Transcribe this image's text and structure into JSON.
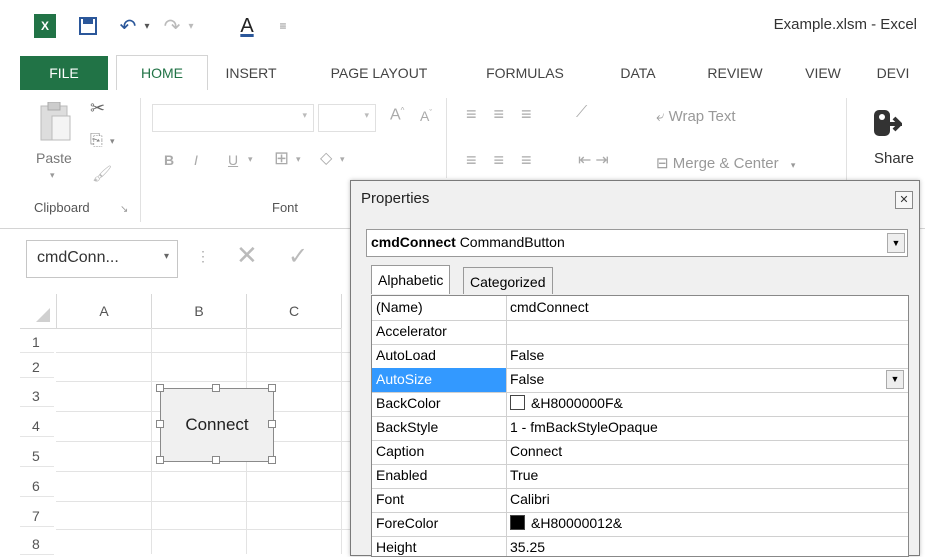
{
  "window": {
    "title": "Example.xlsm - Excel"
  },
  "ribbon": {
    "tabs": [
      {
        "label": "FILE"
      },
      {
        "label": "HOME"
      },
      {
        "label": "INSERT"
      },
      {
        "label": "PAGE LAYOUT"
      },
      {
        "label": "FORMULAS"
      },
      {
        "label": "DATA"
      },
      {
        "label": "REVIEW"
      },
      {
        "label": "VIEW"
      },
      {
        "label": "DEVI"
      }
    ],
    "clipboard": {
      "paste_label": "Paste",
      "group_label": "Clipboard"
    },
    "font": {
      "group_label": "Font",
      "bold": "B",
      "italic": "I",
      "underline": "U",
      "font_color": "A"
    },
    "alignment": {
      "wrap_text": "Wrap Text",
      "merge_center": "Merge & Center"
    },
    "share": {
      "label": "Share"
    }
  },
  "formula_bar": {
    "name_box": "cmdConn...",
    "cancel": "✕",
    "enter": "✓"
  },
  "grid": {
    "columns": [
      "A",
      "B",
      "C"
    ],
    "rows": [
      "1",
      "2",
      "3",
      "4",
      "5",
      "6",
      "7",
      "8"
    ]
  },
  "sheet_button": {
    "label": "Connect"
  },
  "properties": {
    "title": "Properties",
    "object_name": "cmdConnect",
    "object_type": "CommandButton",
    "tabs": [
      {
        "label": "Alphabetic"
      },
      {
        "label": "Categorized"
      }
    ],
    "rows": [
      {
        "name": "(Name)",
        "value": "cmdConnect"
      },
      {
        "name": "Accelerator",
        "value": ""
      },
      {
        "name": "AutoLoad",
        "value": "False"
      },
      {
        "name": "AutoSize",
        "value": "False"
      },
      {
        "name": "BackColor",
        "value": "&H8000000F&"
      },
      {
        "name": "BackStyle",
        "value": "1 - fmBackStyleOpaque"
      },
      {
        "name": "Caption",
        "value": "Connect"
      },
      {
        "name": "Enabled",
        "value": "True"
      },
      {
        "name": "Font",
        "value": "Calibri"
      },
      {
        "name": "ForeColor",
        "value": "&H80000012&"
      },
      {
        "name": "Height",
        "value": "35.25"
      }
    ]
  },
  "colors": {
    "accent": "#217346",
    "selection": "#3399ff",
    "backcolor_swatch": "#ffffff",
    "forecolor_swatch": "#000000"
  }
}
